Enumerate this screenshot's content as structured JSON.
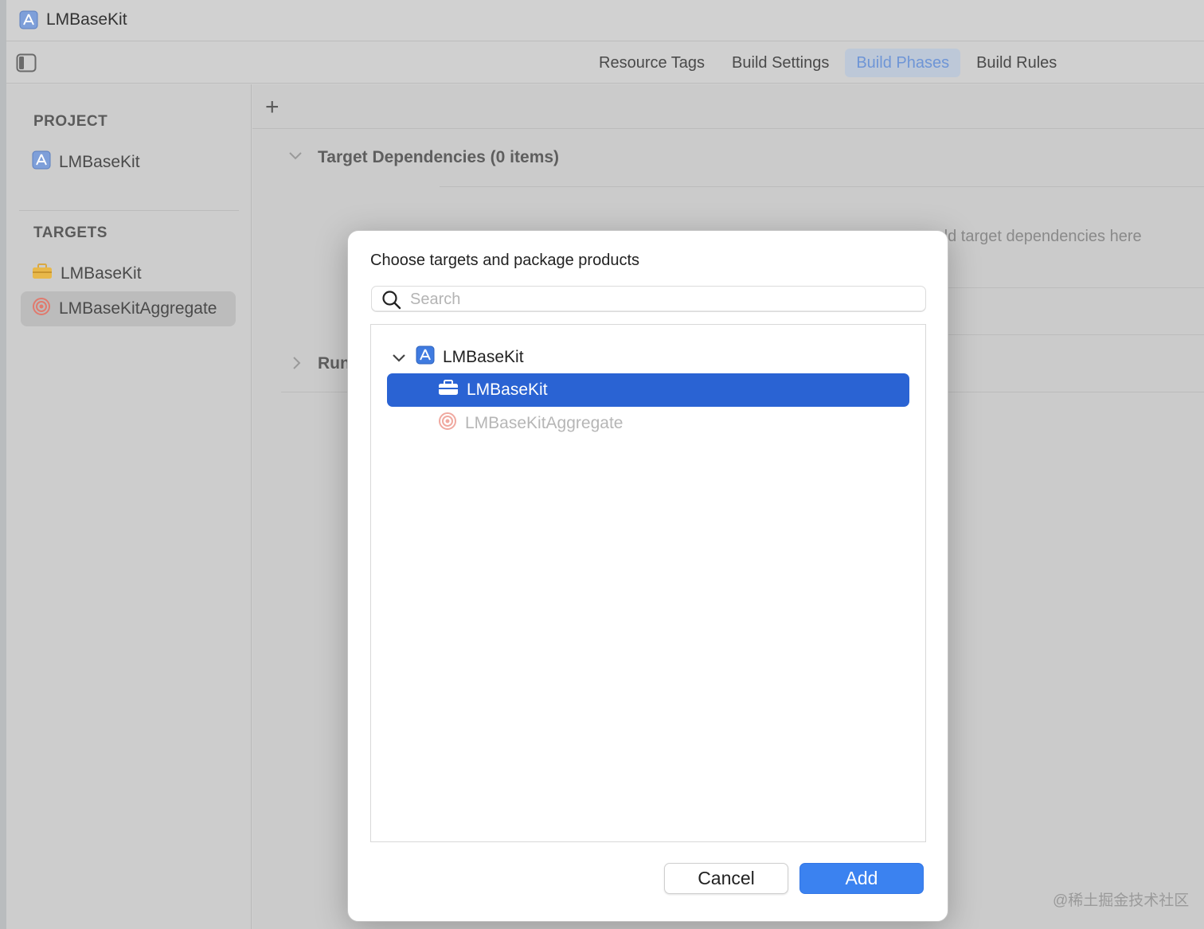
{
  "window": {
    "title": "LMBaseKit"
  },
  "toolbar": {
    "tabs": [
      {
        "label": "Resource Tags"
      },
      {
        "label": "Build Settings"
      },
      {
        "label": "Build Phases"
      },
      {
        "label": "Build Rules"
      }
    ],
    "active_tab": "Build Phases"
  },
  "sidebar": {
    "project_header": "PROJECT",
    "project_items": [
      {
        "label": "LMBaseKit",
        "icon": "xcode-project-icon"
      }
    ],
    "targets_header": "TARGETS",
    "target_items": [
      {
        "label": "LMBaseKit",
        "icon": "framework-toolbox-icon"
      },
      {
        "label": "LMBaseKitAggregate",
        "icon": "aggregate-target-icon"
      }
    ],
    "selected_target": "LMBaseKitAggregate"
  },
  "editor": {
    "add_symbol": "+",
    "phase_target_dependencies": "Target Dependencies (0 items)",
    "placeholder": "dd target dependencies here",
    "phase_run_partial": "Run"
  },
  "dialog": {
    "title": "Choose targets and package products",
    "search": {
      "placeholder": "Search",
      "value": ""
    },
    "tree": {
      "group_label": "LMBaseKit",
      "items": [
        {
          "label": "LMBaseKit",
          "selected": true,
          "enabled": true
        },
        {
          "label": "LMBaseKitAggregate",
          "selected": false,
          "enabled": false
        }
      ]
    },
    "cancel_label": "Cancel",
    "add_label": "Add"
  },
  "watermark": "@稀土掘金技术社区",
  "colors": {
    "accent_blue": "#2a63d3",
    "add_button": "#3b82f0",
    "active_tab_text": "#6e95d6",
    "aggregate_red": "#e05a4a",
    "toolbox_yellow": "#e8b84a"
  }
}
